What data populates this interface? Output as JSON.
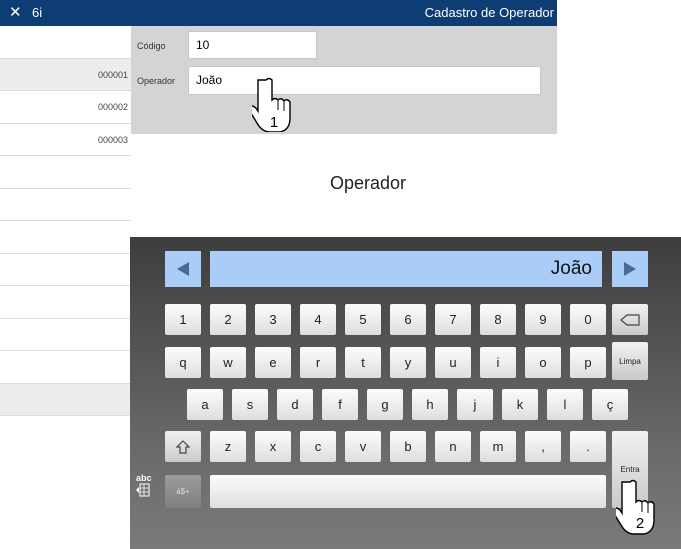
{
  "titlebar": {
    "close_glyph": "✕",
    "app_name": "6i",
    "window_title": "Cadastro de Operador"
  },
  "sidebar": {
    "rows": [
      "",
      "000001",
      "000002",
      "000003",
      "",
      "",
      "",
      "",
      "",
      "",
      "",
      ""
    ]
  },
  "form": {
    "codigo_label": "Código",
    "codigo_value": "10",
    "operador_label": "Operador",
    "operador_value": "João"
  },
  "caption": "Operador",
  "keyboard": {
    "display_value": "João",
    "row1": [
      "1",
      "2",
      "3",
      "4",
      "5",
      "6",
      "7",
      "8",
      "9",
      "0"
    ],
    "row2": [
      "q",
      "w",
      "e",
      "r",
      "t",
      "y",
      "u",
      "i",
      "o",
      "p"
    ],
    "row3": [
      "a",
      "s",
      "d",
      "f",
      "g",
      "h",
      "j",
      "k",
      "l",
      "ç"
    ],
    "row4": [
      "z",
      "x",
      "c",
      "v",
      "b",
      "n",
      "m",
      ",",
      "."
    ],
    "limpa_label": "Limpa",
    "entra_label": "Entra",
    "symbols_label": "á$+",
    "layout_label": "abc",
    "colors": {
      "display_bg": "#a9cdf7",
      "arrow": "#4a6a8e"
    }
  },
  "annotations": {
    "step1": "1",
    "step2": "2"
  }
}
